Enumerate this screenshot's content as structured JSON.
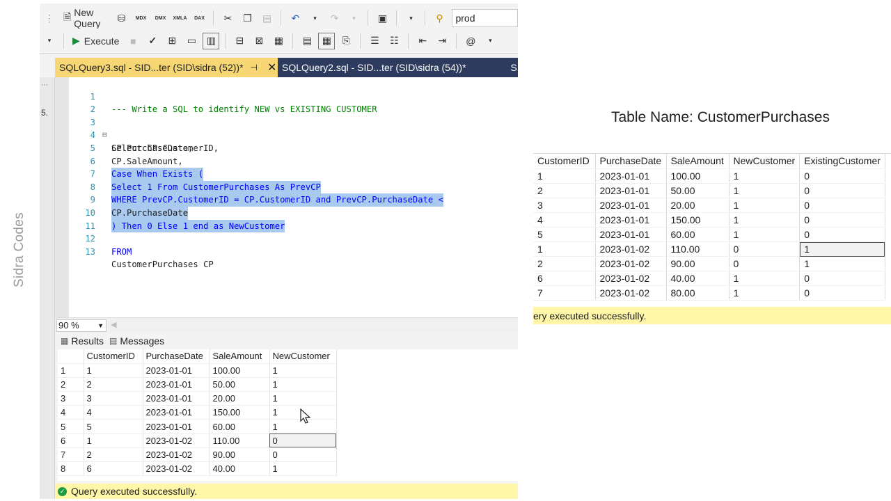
{
  "watermark": "Sidra Codes",
  "toolbar": {
    "new_query": "New Query",
    "execute": "Execute",
    "database": "prod",
    "icons": [
      "mdx-icon",
      "dmx-icon",
      "xmla-icon",
      "dax-icon"
    ]
  },
  "tabs": [
    {
      "label": "SQLQuery3.sql - SID...ter (SID\\sidra (52))*",
      "active": true
    },
    {
      "label": "SQLQuery2.sql - SID...ter (SID\\sidra (54))*",
      "active": false
    },
    {
      "label": "S",
      "active": false
    }
  ],
  "editor": {
    "lines": [
      {
        "n": "1",
        "text": "--- Write a SQL to identify NEW vs EXISTING CUSTOMER"
      },
      {
        "n": "2",
        "text": ""
      },
      {
        "n": "3",
        "text": "Select CP.CustomerID,"
      },
      {
        "n": "4",
        "text": "CP.PurchaseDate,"
      },
      {
        "n": "5",
        "text": "CP.SaleAmount,"
      },
      {
        "n": "6",
        "text": "Case When Exists ("
      },
      {
        "n": "7",
        "text": "Select 1 From CustomerPurchases As PrevCP"
      },
      {
        "n": "8",
        "text": "WHERE PrevCP.CustomerID = CP.CustomerID and PrevCP.PurchaseDate <"
      },
      {
        "n": "9",
        "text": "CP.PurchaseDate"
      },
      {
        "n": "10",
        "text": ") Then 0 Else 1 end as NewCustomer"
      },
      {
        "n": "11",
        "text": ""
      },
      {
        "n": "12",
        "text": "FROM"
      },
      {
        "n": "13",
        "text": "CustomerPurchases CP"
      }
    ]
  },
  "zoom": "90 %",
  "result_tabs": {
    "results": "Results",
    "messages": "Messages"
  },
  "results": {
    "columns": [
      "CustomerID",
      "PurchaseDate",
      "SaleAmount",
      "NewCustomer"
    ],
    "rows": [
      {
        "n": "1",
        "cells": [
          "1",
          "2023-01-01",
          "100.00",
          "1"
        ]
      },
      {
        "n": "2",
        "cells": [
          "2",
          "2023-01-01",
          "50.00",
          "1"
        ]
      },
      {
        "n": "3",
        "cells": [
          "3",
          "2023-01-01",
          "20.00",
          "1"
        ]
      },
      {
        "n": "4",
        "cells": [
          "4",
          "2023-01-01",
          "150.00",
          "1"
        ]
      },
      {
        "n": "5",
        "cells": [
          "5",
          "2023-01-01",
          "60.00",
          "1"
        ]
      },
      {
        "n": "6",
        "cells": [
          "1",
          "2023-01-02",
          "110.00",
          "0"
        ]
      },
      {
        "n": "7",
        "cells": [
          "2",
          "2023-01-02",
          "90.00",
          "0"
        ]
      },
      {
        "n": "8",
        "cells": [
          "6",
          "2023-01-02",
          "40.00",
          "1"
        ]
      }
    ]
  },
  "status_left": "Query executed successfully.",
  "right": {
    "title": "Table Name: CustomerPurchases",
    "columns": [
      "CustomerID",
      "PurchaseDate",
      "SaleAmount",
      "NewCustomer",
      "ExistingCustomer"
    ],
    "rows": [
      [
        "1",
        "2023-01-01",
        "100.00",
        "1",
        "0"
      ],
      [
        "2",
        "2023-01-01",
        "50.00",
        "1",
        "0"
      ],
      [
        "3",
        "2023-01-01",
        "20.00",
        "1",
        "0"
      ],
      [
        "4",
        "2023-01-01",
        "150.00",
        "1",
        "0"
      ],
      [
        "5",
        "2023-01-01",
        "60.00",
        "1",
        "0"
      ],
      [
        "1",
        "2023-01-02",
        "110.00",
        "0",
        "1"
      ],
      [
        "2",
        "2023-01-02",
        "90.00",
        "0",
        "1"
      ],
      [
        "6",
        "2023-01-02",
        "40.00",
        "1",
        "0"
      ],
      [
        "7",
        "2023-01-02",
        "80.00",
        "1",
        "0"
      ]
    ],
    "status": "ery executed successfully."
  },
  "colors": {
    "tab_active": "#f7d774",
    "tab_bar": "#2d3b5e",
    "status": "#fff6a8",
    "selection": "#a9c9ee"
  }
}
